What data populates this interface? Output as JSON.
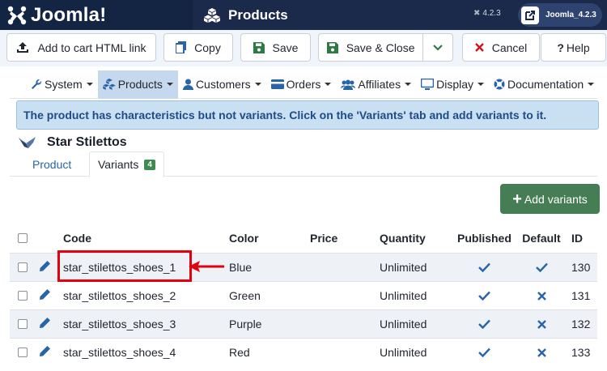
{
  "header": {
    "app_name": "Joomla!",
    "page_title": "Products",
    "version": "4.2.3",
    "user_label": "Joomla_4.2.3"
  },
  "toolbar": {
    "add_to_cart": "Add to cart HTML link",
    "copy": "Copy",
    "save": "Save",
    "save_close": "Save & Close",
    "cancel": "Cancel",
    "help": "Help"
  },
  "menu": {
    "items": [
      {
        "label": "System",
        "icon": "wrench-icon"
      },
      {
        "label": "Products",
        "icon": "cubes-icon",
        "active": true
      },
      {
        "label": "Customers",
        "icon": "user-icon"
      },
      {
        "label": "Orders",
        "icon": "credit-card-icon"
      },
      {
        "label": "Affiliates",
        "icon": "users-icon"
      },
      {
        "label": "Display",
        "icon": "monitor-icon"
      },
      {
        "label": "Documentation",
        "icon": "life-ring-icon"
      }
    ]
  },
  "alert": {
    "message": "The product has characteristics but not variants. Click on the 'Variants' tab and add variants to it."
  },
  "product": {
    "name": "Star Stilettos"
  },
  "tabs": {
    "product": "Product",
    "variants": "Variants",
    "variants_count": "4"
  },
  "add_variants": "Add variants",
  "table": {
    "headers": {
      "code": "Code",
      "color": "Color",
      "price": "Price",
      "quantity": "Quantity",
      "published": "Published",
      "default": "Default",
      "id": "ID"
    },
    "rows": [
      {
        "code": "star_stilettos_shoes_1",
        "color": "Blue",
        "price": "",
        "quantity": "Unlimited",
        "published": true,
        "default": true,
        "id": "130"
      },
      {
        "code": "star_stilettos_shoes_2",
        "color": "Green",
        "price": "",
        "quantity": "Unlimited",
        "published": true,
        "default": false,
        "id": "131"
      },
      {
        "code": "star_stilettos_shoes_3",
        "color": "Purple",
        "price": "",
        "quantity": "Unlimited",
        "published": true,
        "default": false,
        "id": "132"
      },
      {
        "code": "star_stilettos_shoes_4",
        "color": "Red",
        "price": "",
        "quantity": "Unlimited",
        "published": true,
        "default": false,
        "id": "133"
      }
    ]
  },
  "colors": {
    "header_bg": "#1b2a4a",
    "accent_blue": "#2a64a8",
    "success_green": "#457d54",
    "danger_red": "#e3000f"
  }
}
